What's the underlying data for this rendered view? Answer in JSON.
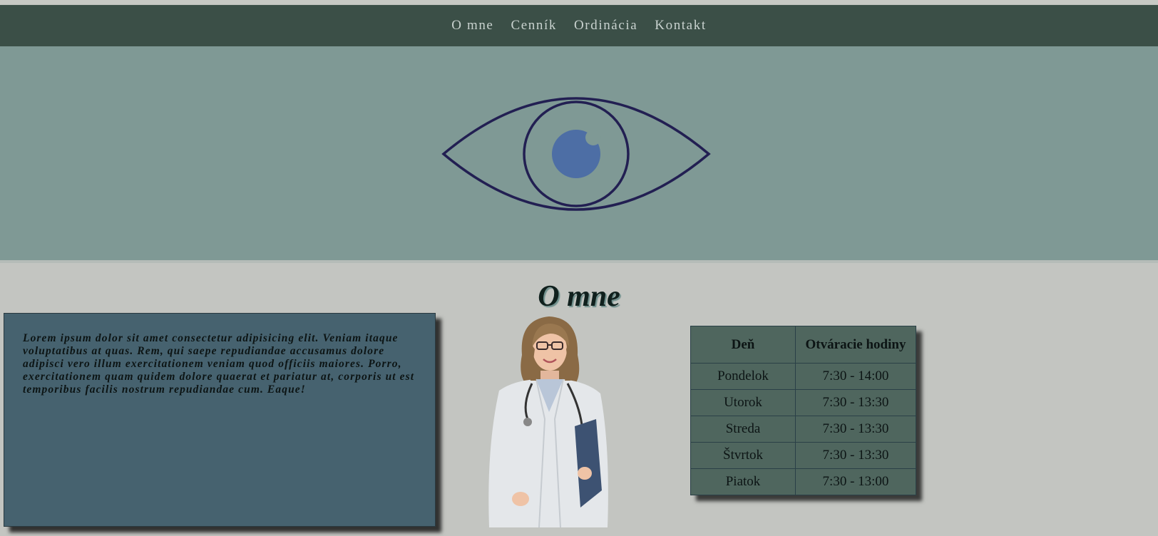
{
  "nav": {
    "links": [
      "O mne",
      "Cenník",
      "Ordinácia",
      "Kontakt"
    ]
  },
  "hero": {
    "icon": "eye-icon",
    "colors": {
      "background": "#7f9995",
      "stroke": "#221f52",
      "iris": "#4d6ea5"
    }
  },
  "about": {
    "title": "O mne",
    "text": "Lorem ipsum dolor sit amet consectetur adipisicing elit. Veniam itaque voluptatibus at quas. Rem, qui saepe repudiandae accusamus dolore adipisci vero illum exercitationem veniam quod officiis maiores. Porro, exercitationem quam quidem dolore quaerat et pariatur at, corporis ut est temporibus facilis nostrum repudiandae cum. Eaque!"
  },
  "hours": {
    "headers": [
      "Deň",
      "Otváracie hodiny"
    ],
    "rows": [
      [
        "Pondelok",
        "7:30 - 14:00"
      ],
      [
        "Utorok",
        "7:30 - 13:30"
      ],
      [
        "Streda",
        "7:30 - 13:30"
      ],
      [
        "Štvrtok",
        "7:30 - 13:30"
      ],
      [
        "Piatok",
        "7:30 - 13:00"
      ]
    ]
  },
  "colors": {
    "navbar": "#3b4f47",
    "page_bg": "#c3c5c1",
    "text_box": "#46626f",
    "table_bg": "#4f665e"
  }
}
